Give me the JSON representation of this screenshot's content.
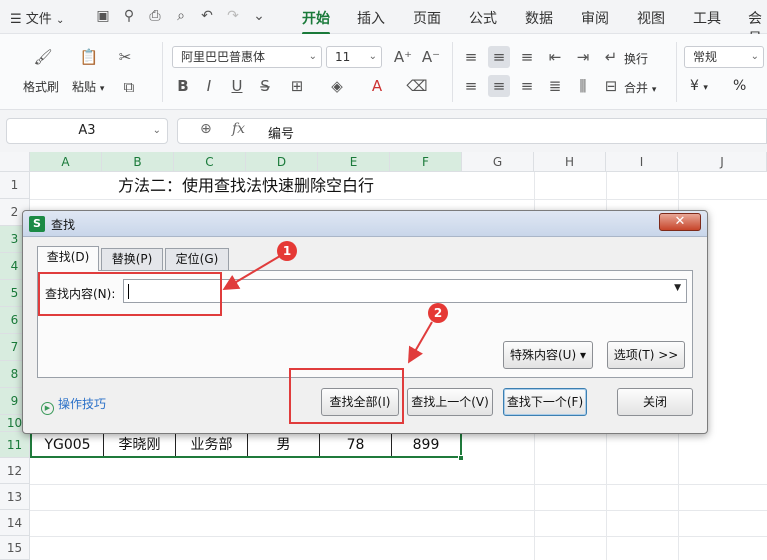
{
  "tabbar": {
    "file_label": "文件",
    "tabs": [
      "开始",
      "插入",
      "页面",
      "公式",
      "数据",
      "审阅",
      "视图",
      "工具",
      "会员"
    ],
    "active_tab": "开始"
  },
  "ribbon": {
    "format_painter": "格式刷",
    "paste": "粘贴",
    "font_name": "阿里巴巴普惠体",
    "font_size": "11",
    "wrap_text": "换行",
    "merge": "合并",
    "number_format": "常规",
    "percent": "%",
    "yen": "¥"
  },
  "formula_bar": {
    "cell_ref": "A3",
    "fx": "fx",
    "value": "编号"
  },
  "grid": {
    "columns": [
      "A",
      "B",
      "C",
      "D",
      "E",
      "F",
      "G",
      "H",
      "I",
      "J"
    ],
    "rows": [
      "1",
      "2",
      "3",
      "4",
      "5",
      "6",
      "7",
      "8",
      "9",
      "10",
      "11",
      "12",
      "13",
      "14",
      "15"
    ],
    "title": "方法二：使用查找法快速删除空白行",
    "row11": [
      "YG005",
      "李晓刚",
      "业务部",
      "男",
      "78",
      "899"
    ]
  },
  "dialog": {
    "title": "查找",
    "logo": "S",
    "close": "✕",
    "tabs": [
      "查找(D)",
      "替换(P)",
      "定位(G)"
    ],
    "find_label": "查找内容(N):",
    "find_value": "",
    "special_button": "特殊内容(U) ▾",
    "options_button": "选项(T) >>",
    "tips_link": "操作技巧",
    "find_all": "查找全部(I)",
    "find_prev": "查找上一个(V)",
    "find_next": "查找下一个(F)",
    "close_button": "关闭"
  },
  "annotations": {
    "badge1": "1",
    "badge2": "2",
    "color": "#e03c3c"
  }
}
